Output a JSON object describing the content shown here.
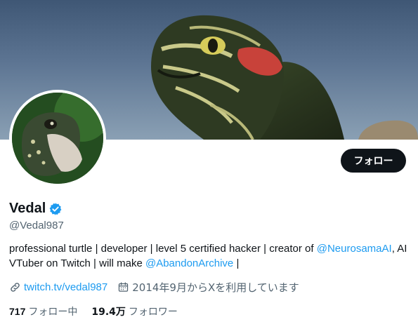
{
  "profile": {
    "display_name": "Vedal",
    "handle": "@Vedal987",
    "follow_button": "フォロー",
    "bio": {
      "text1": "professional turtle | developer | level 5 certified hacker | creator of ",
      "mention1": "@NeurosamaAI",
      "text2": ", AI VTuber on Twitch | will make ",
      "mention2": "@AbandonArchive",
      "text3": " |"
    },
    "website": "twitch.tv/vedal987",
    "joined": "2014年9月からXを利用しています",
    "following_count": "717",
    "following_label": "フォロー中",
    "followers_count": "19.4万",
    "followers_label": "フォロワー"
  },
  "icons": {
    "verified": "verified-badge-icon",
    "link": "link-icon",
    "calendar": "calendar-icon"
  },
  "colors": {
    "accent": "#1d9bf0",
    "text": "#0f1419",
    "muted": "#536471",
    "button_bg": "#0f1419"
  }
}
